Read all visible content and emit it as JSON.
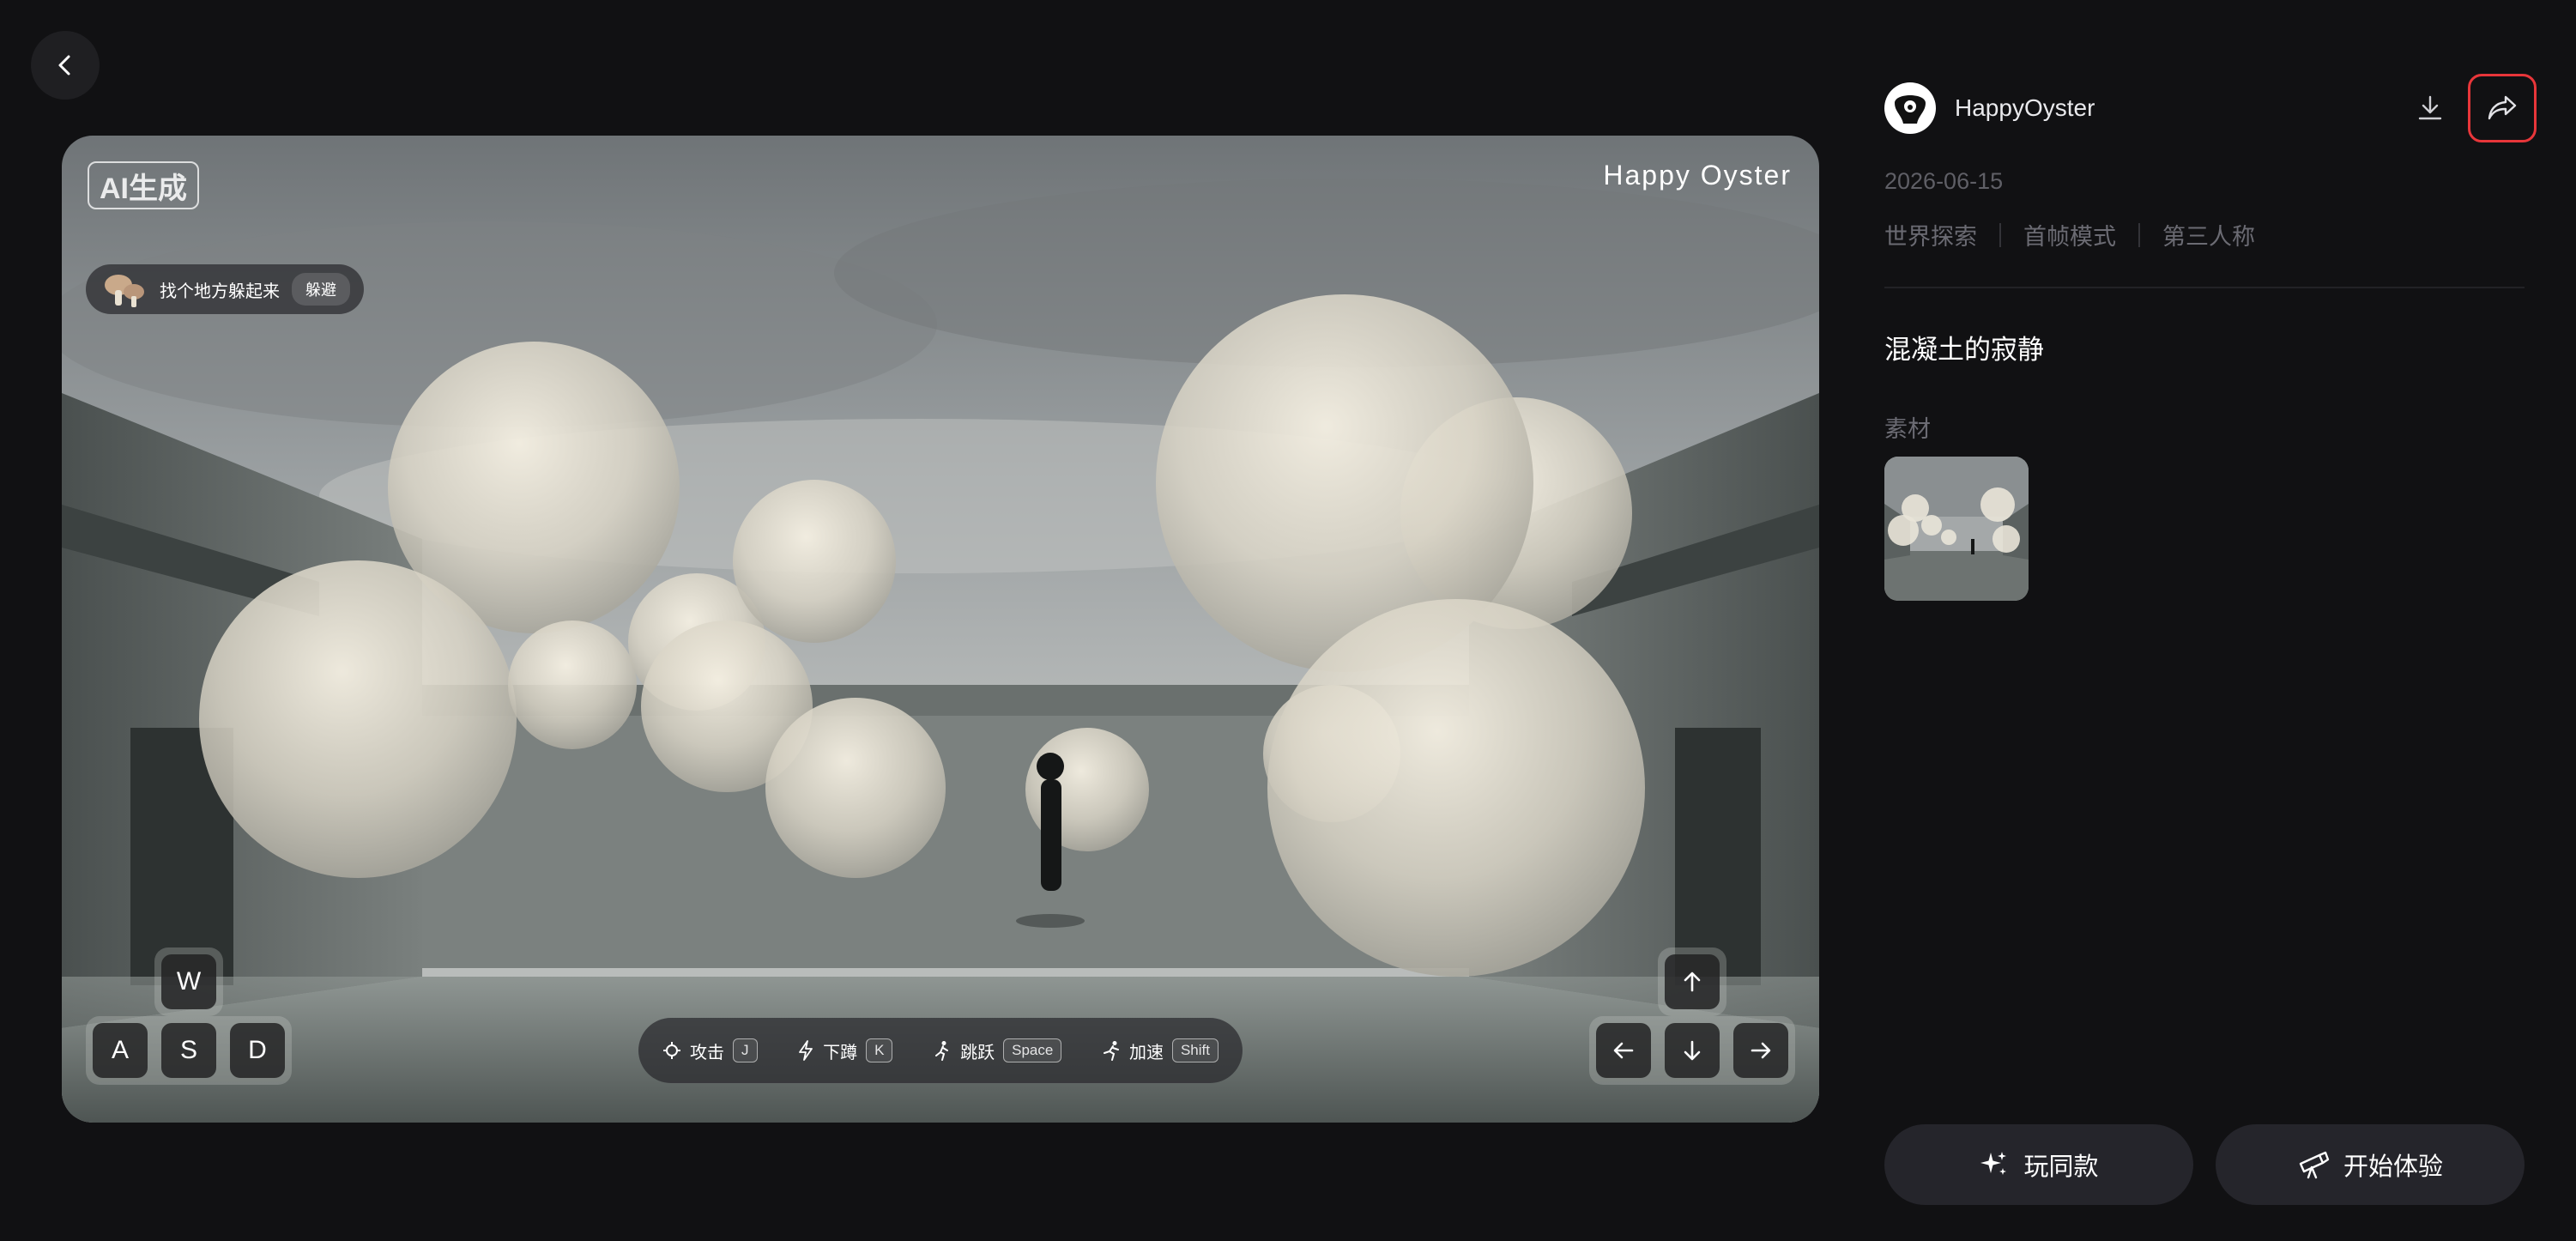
{
  "stage": {
    "ai_badge": "AI生成",
    "brand": "Happy Oyster",
    "quest": {
      "text": "找个地方躲起来",
      "tag": "躲避"
    },
    "keys": [
      "W",
      "A",
      "S",
      "D"
    ],
    "actions": [
      {
        "label": "攻击",
        "key": "J",
        "icon": "crosshair-icon"
      },
      {
        "label": "下蹲",
        "key": "K",
        "icon": "lightning-icon"
      },
      {
        "label": "跳跃",
        "key": "Space",
        "icon": "jump-icon"
      },
      {
        "label": "加速",
        "key": "Shift",
        "icon": "run-icon"
      }
    ]
  },
  "panel": {
    "author": "HappyOyster",
    "date": "2026-06-15",
    "tags": [
      "世界探索",
      "首帧模式",
      "第三人称"
    ],
    "title": "混凝土的寂静",
    "material_label": "素材",
    "buttons": {
      "same": "玩同款",
      "start": "开始体验"
    }
  },
  "colors": {
    "background": "#111113",
    "share_highlight": "#e8363a",
    "button_bg": "#25252b"
  }
}
